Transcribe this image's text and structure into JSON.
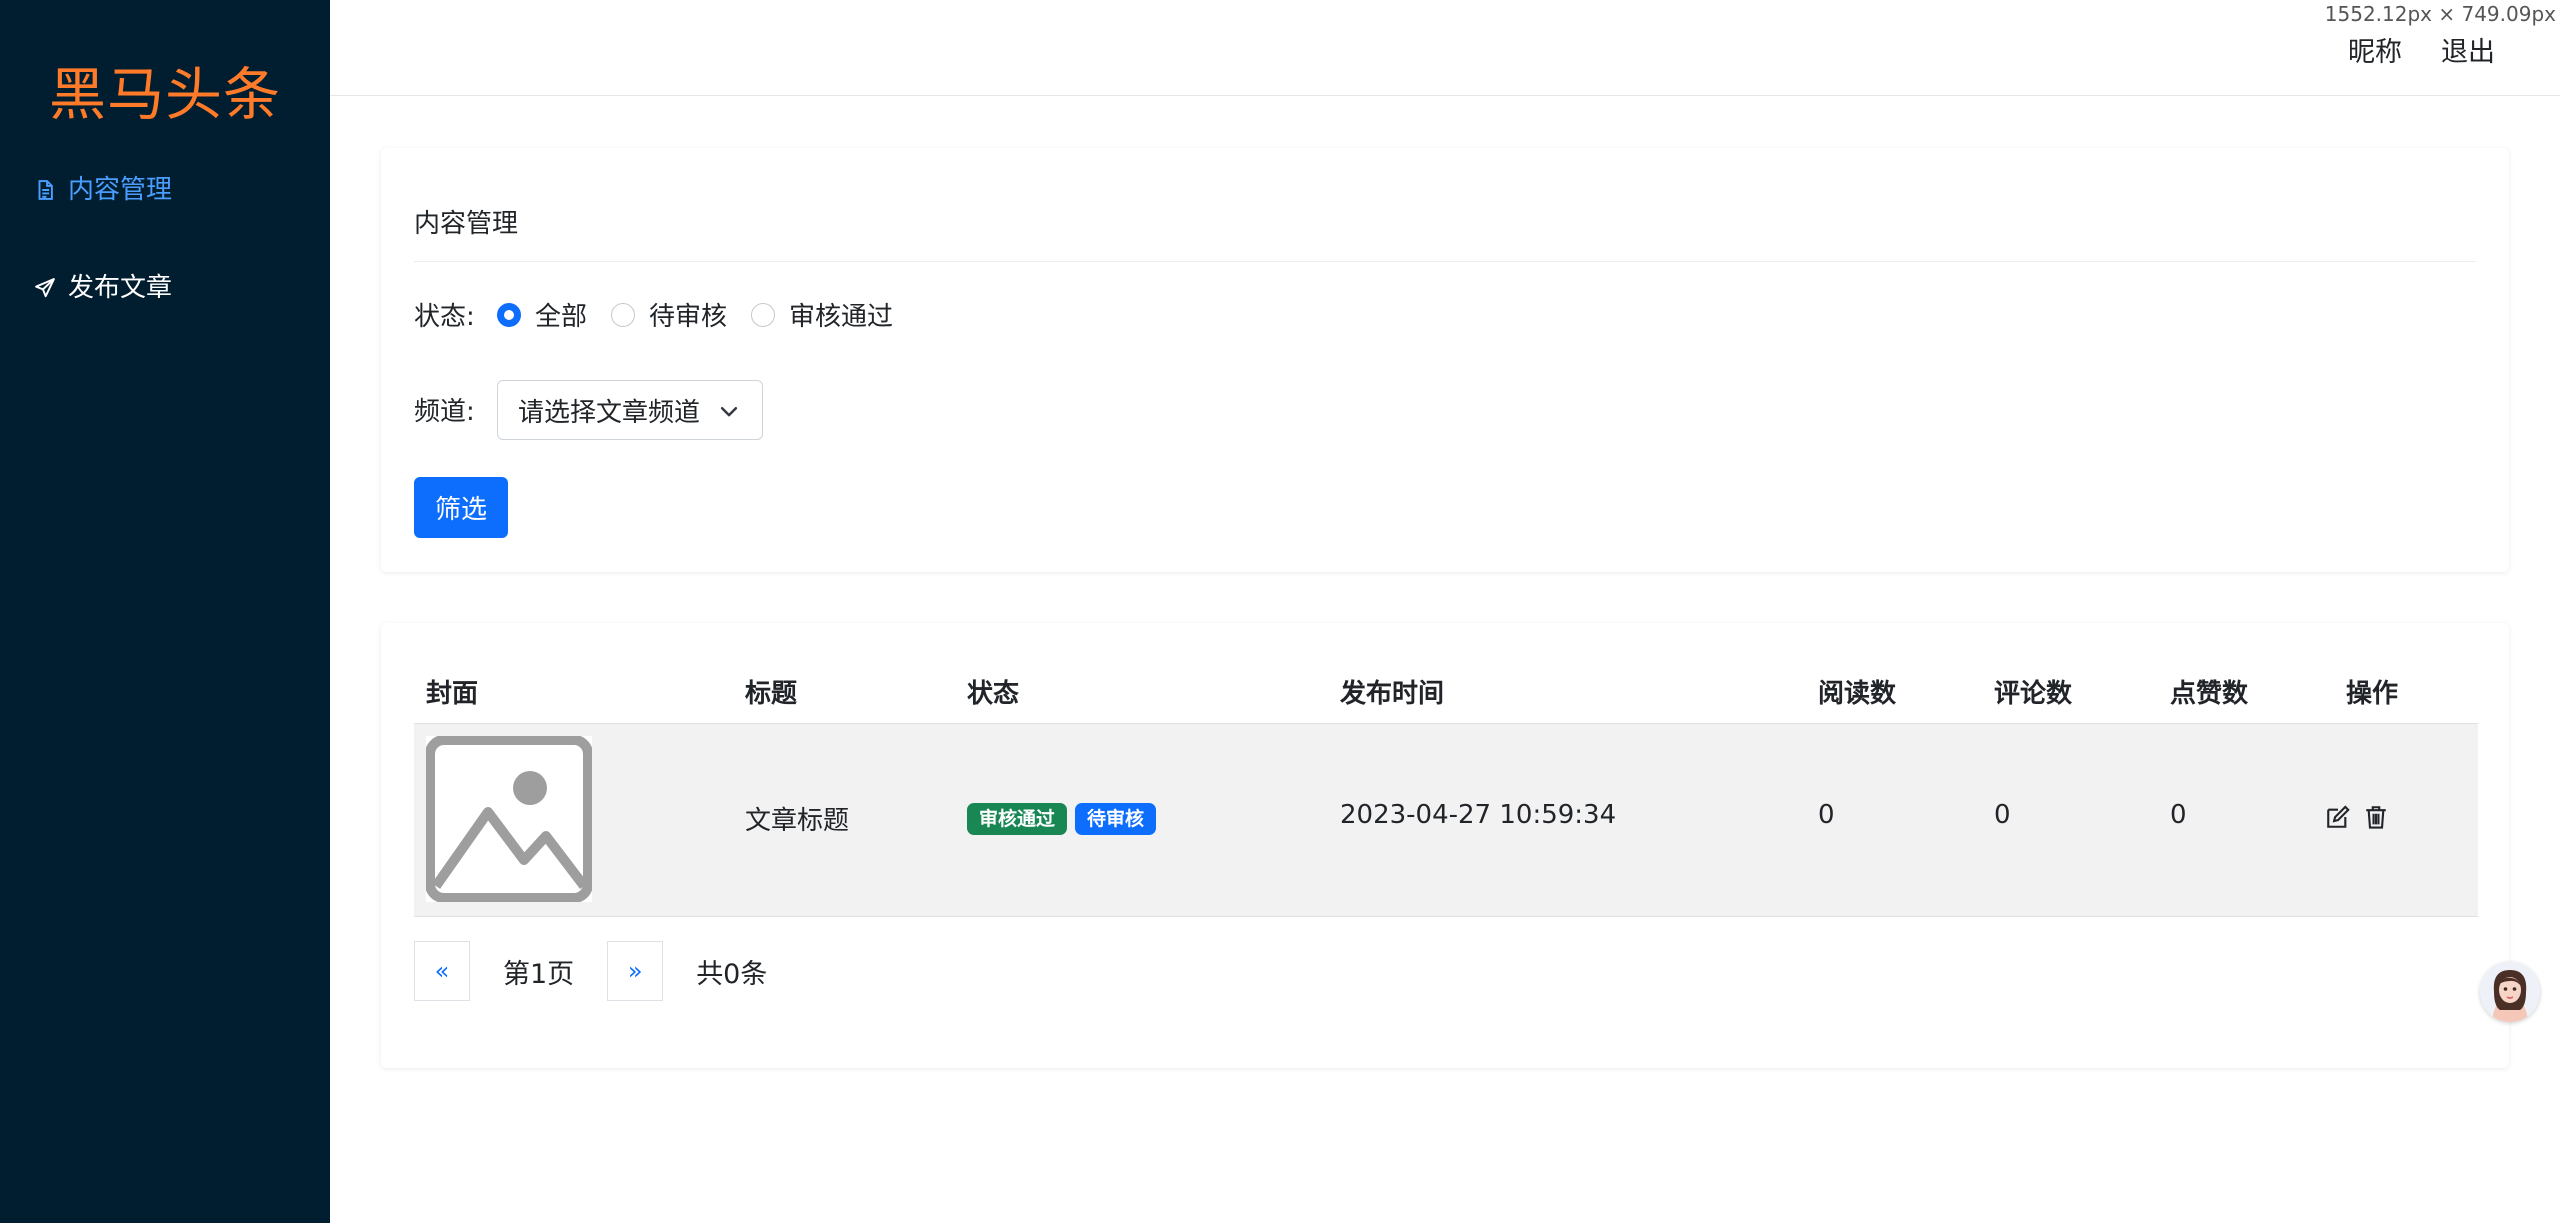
{
  "dimension_label": "1552.12px × 749.09px",
  "brand": {
    "title": "黑马头条",
    "color": "#ff7a29"
  },
  "sidebar": {
    "items": [
      {
        "label": "内容管理",
        "icon": "file-text-icon",
        "active": true
      },
      {
        "label": "发布文章",
        "icon": "send-icon",
        "active": false
      }
    ]
  },
  "topbar": {
    "nickname": "昵称",
    "logout": "退出"
  },
  "filter": {
    "title": "内容管理",
    "status_label": "状态:",
    "status_options": [
      {
        "label": "全部",
        "checked": true
      },
      {
        "label": "待审核",
        "checked": false
      },
      {
        "label": "审核通过",
        "checked": false
      }
    ],
    "channel_label": "频道:",
    "channel_placeholder": "请选择文章频道",
    "filter_button": "筛选"
  },
  "table": {
    "headers": [
      "封面",
      "标题",
      "状态",
      "发布时间",
      "阅读数",
      "评论数",
      "点赞数",
      "操作"
    ],
    "rows": [
      {
        "cover": "image-placeholder-icon",
        "title": "文章标题",
        "badges": [
          {
            "label": "审核通过",
            "color": "#198754"
          },
          {
            "label": "待审核",
            "color": "#0d6efd"
          }
        ],
        "publish_time": "2023-04-27 10:59:34",
        "reads": "0",
        "comments": "0",
        "likes": "0",
        "actions": [
          "edit-icon",
          "trash-icon"
        ]
      }
    ]
  },
  "pagination": {
    "prev": "«",
    "page_text": "第1页",
    "next": "»",
    "total_text": "共0条"
  },
  "colors": {
    "sidebar_bg": "#001e30",
    "primary": "#0d6efd",
    "active_nav": "#4a9eff"
  }
}
